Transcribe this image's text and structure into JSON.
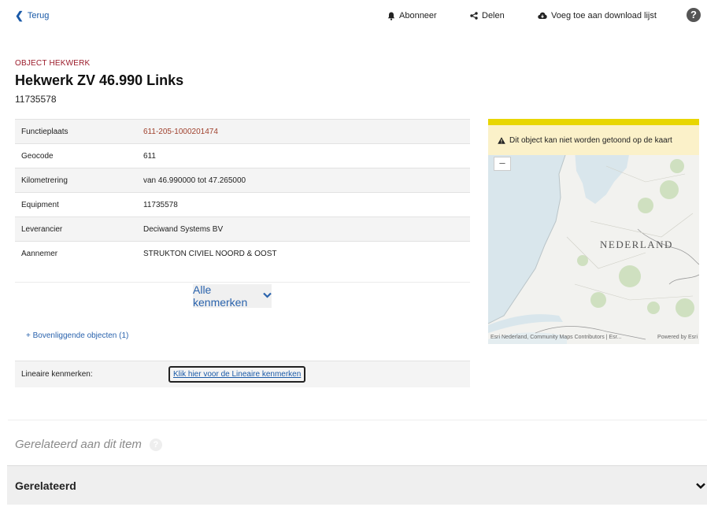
{
  "nav": {
    "back_label": "Terug",
    "subscribe_label": "Abonneer",
    "share_label": "Delen",
    "download_label": "Voeg toe aan download lijst",
    "help_icon": "?"
  },
  "header": {
    "object_type": "OBJECT HEKWERK",
    "title": "Hekwerk ZV 46.990 Links",
    "id": "11735578"
  },
  "attributes": [
    {
      "key": "Functieplaats",
      "value": "611-205-1000201474"
    },
    {
      "key": "Geocode",
      "value": "611"
    },
    {
      "key": "Kilometrering",
      "value": "van 46.990000 tot 47.265000"
    },
    {
      "key": "Equipment",
      "value": "11735578"
    },
    {
      "key": "Leverancier",
      "value": "Deciwand Systems BV"
    },
    {
      "key": "Aannemer",
      "value": "STRUKTON CIVIEL NOORD & OOST"
    }
  ],
  "more_button": {
    "label": "Alle kenmerken",
    "chevron": "❯"
  },
  "parent_objects_link": "+ Bovenliggende objecten (1)",
  "linear": {
    "label": "Lineaire kenmerken:",
    "button": "Klik hier voor de Lineaire kenmerken"
  },
  "map": {
    "warning": "Dit object kan niet worden getoond op de kaart",
    "zoom_out": "–",
    "country_label": "NEDERLAND",
    "attribution": "Esri Nederland, Community Maps Contributors | Esr...",
    "powered_by": "Powered by Esri",
    "colors": {
      "warning_bar": "#e8d600",
      "warning_bg": "#fbf1c9",
      "water": "#d6e4ea"
    }
  },
  "related_heading": "Gerelateerd aan dit item",
  "accordion": {
    "label": "Gerelateerd"
  },
  "colors": {
    "accent_link": "#2a63ad",
    "type_label": "#9b1b2a",
    "functieplaats": "#a0412d"
  }
}
